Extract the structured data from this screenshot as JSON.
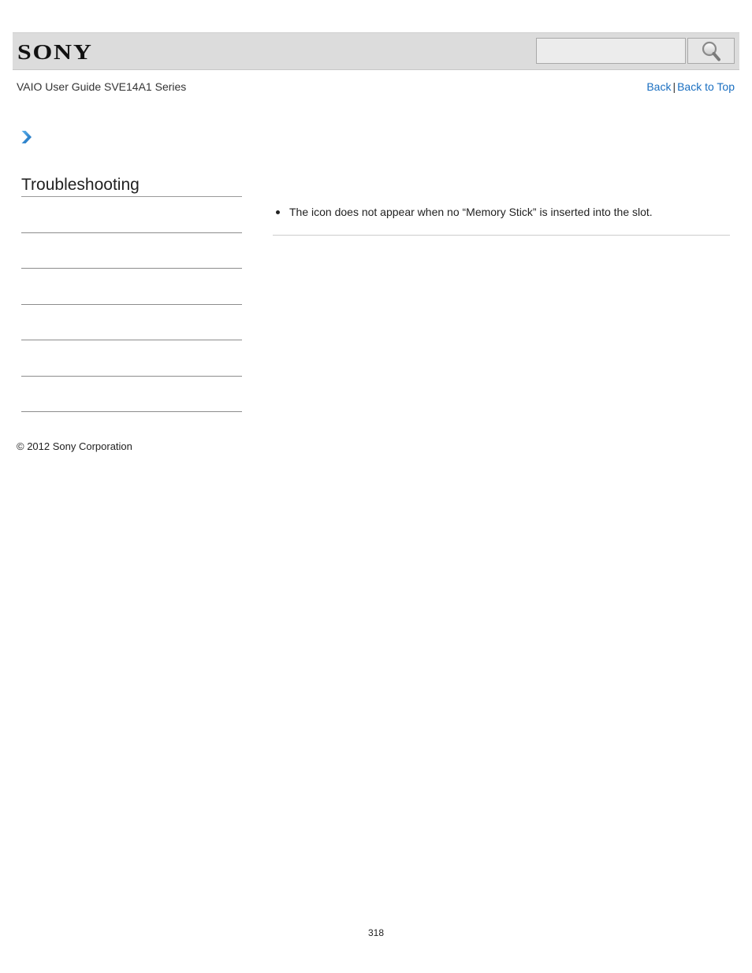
{
  "header": {
    "brand": "SONY",
    "search": {
      "value": "",
      "placeholder": ""
    },
    "search_icon": "magnifier-icon"
  },
  "nav": {
    "guide_title": "VAIO User Guide SVE14A1 Series",
    "back_label": "Back",
    "separator": "|",
    "back_to_top_label": "Back to Top"
  },
  "breadcrumb": {
    "icon": "chevron-right-icon"
  },
  "sidebar": {
    "title": "Troubleshooting"
  },
  "content": {
    "items": [
      "The icon does not appear when no “Memory Stick” is inserted into the slot."
    ]
  },
  "footer": {
    "copyright": "© 2012 Sony Corporation",
    "page_number": "318"
  },
  "colors": {
    "link": "#1a6fc1",
    "header_bar": "#dcdcdc",
    "chevron": "#1e88d8"
  }
}
